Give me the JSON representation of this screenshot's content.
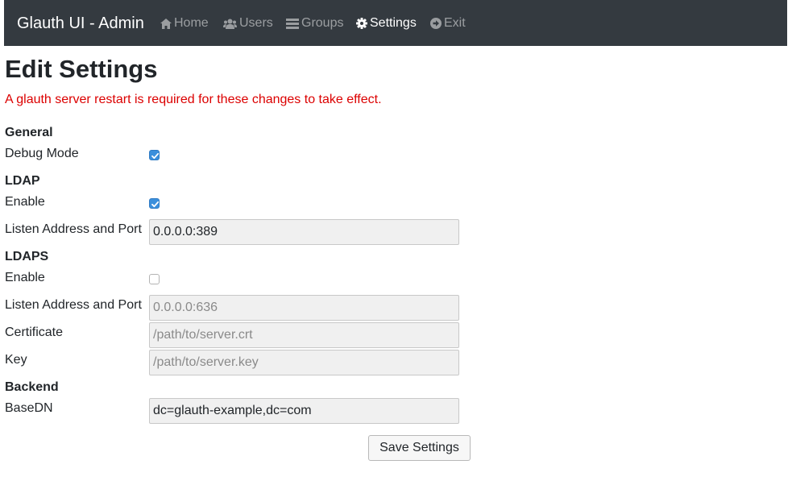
{
  "navbar": {
    "brand": "Glauth UI - Admin",
    "links": [
      {
        "label": "Home",
        "icon": "home-icon",
        "active": false
      },
      {
        "label": "Users",
        "icon": "users-icon",
        "active": false
      },
      {
        "label": "Groups",
        "icon": "groups-icon",
        "active": false
      },
      {
        "label": "Settings",
        "icon": "gear-icon",
        "active": true
      },
      {
        "label": "Exit",
        "icon": "exit-icon",
        "active": false
      }
    ]
  },
  "page": {
    "title": "Edit Settings",
    "warning": "A glauth server restart is required for these changes to take effect."
  },
  "general": {
    "heading": "General",
    "debug_mode": {
      "label": "Debug Mode",
      "checked": true
    }
  },
  "ldap": {
    "heading": "LDAP",
    "enable": {
      "label": "Enable",
      "checked": true
    },
    "listen": {
      "label": "Listen Address and Port",
      "value": "0.0.0.0:389"
    }
  },
  "ldaps": {
    "heading": "LDAPS",
    "enable": {
      "label": "Enable",
      "checked": false
    },
    "listen": {
      "label": "Listen Address and Port",
      "placeholder": "0.0.0.0:636"
    },
    "certificate": {
      "label": "Certificate",
      "placeholder": "/path/to/server.crt"
    },
    "key": {
      "label": "Key",
      "placeholder": "/path/to/server.key"
    }
  },
  "backend": {
    "heading": "Backend",
    "basedn": {
      "label": "BaseDN",
      "value": "dc=glauth-example,dc=com"
    }
  },
  "actions": {
    "save_label": "Save Settings"
  },
  "colors": {
    "navbar_bg": "#343a40",
    "warning_text": "#dc0000",
    "checkbox_checked": "#3b8fdc"
  }
}
